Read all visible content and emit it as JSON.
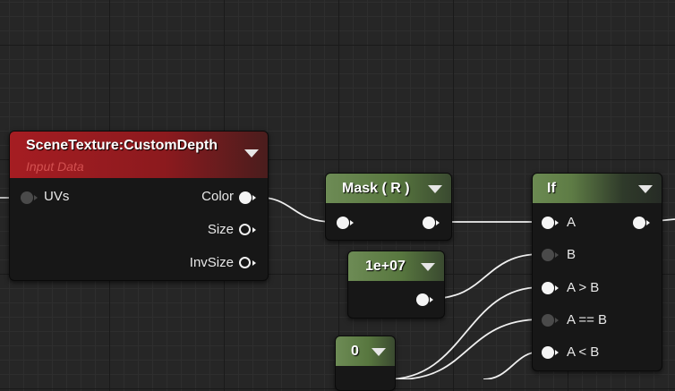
{
  "nodes": {
    "scene_texture": {
      "title": "SceneTexture:CustomDepth",
      "subtitle": "Input Data",
      "inputs": [
        "UVs"
      ],
      "outputs": [
        "Color",
        "Size",
        "InvSize"
      ]
    },
    "mask": {
      "title": "Mask ( R )"
    },
    "constant_a": {
      "title": "1e+07"
    },
    "constant_b": {
      "title": "0"
    },
    "if_node": {
      "title": "If",
      "inputs": [
        "A",
        "B",
        "A > B",
        "A == B",
        "A < B"
      ]
    }
  },
  "colors": {
    "grid_bg": "#262626",
    "node_body": "#171717",
    "header_green": "#58773f",
    "header_red": "#8c1a1e",
    "subtitle_red": "#d25050",
    "wire": "#ffffff"
  }
}
